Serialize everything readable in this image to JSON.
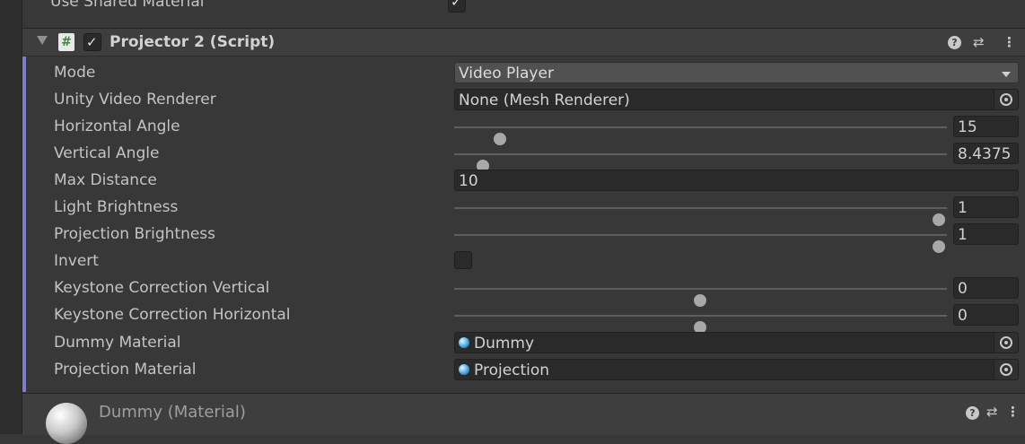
{
  "top_row": {
    "label": "Use Shared Material",
    "checked": true
  },
  "component": {
    "script_icon": "#",
    "title": "Projector 2 (Script)",
    "enabled": true,
    "accent_color": "#7f7fc9"
  },
  "properties": {
    "mode": {
      "label": "Mode",
      "value": "Video Player"
    },
    "unity_video_renderer": {
      "label": "Unity Video Renderer",
      "value": "None (Mesh Renderer)"
    },
    "horizontal_angle": {
      "label": "Horizontal Angle",
      "value": "15"
    },
    "vertical_angle": {
      "label": "Vertical Angle",
      "value": "8.4375"
    },
    "max_distance": {
      "label": "Max Distance",
      "value": "10"
    },
    "light_brightness": {
      "label": "Light Brightness",
      "value": "1"
    },
    "projection_brightness": {
      "label": "Projection Brightness",
      "value": "1"
    },
    "invert": {
      "label": "Invert",
      "checked": false
    },
    "keystone_vertical": {
      "label": "Keystone Correction Vertical",
      "value": "0"
    },
    "keystone_horizontal": {
      "label": "Keystone Correction Horizontal",
      "value": "0"
    },
    "dummy_material": {
      "label": "Dummy Material",
      "value": "Dummy"
    },
    "projection_material": {
      "label": "Projection Material",
      "value": "Projection"
    }
  },
  "material_header": {
    "title": "Dummy (Material)"
  },
  "icons": {
    "check": "✓",
    "help": "?",
    "presets": "⇄",
    "more": "⋮"
  }
}
